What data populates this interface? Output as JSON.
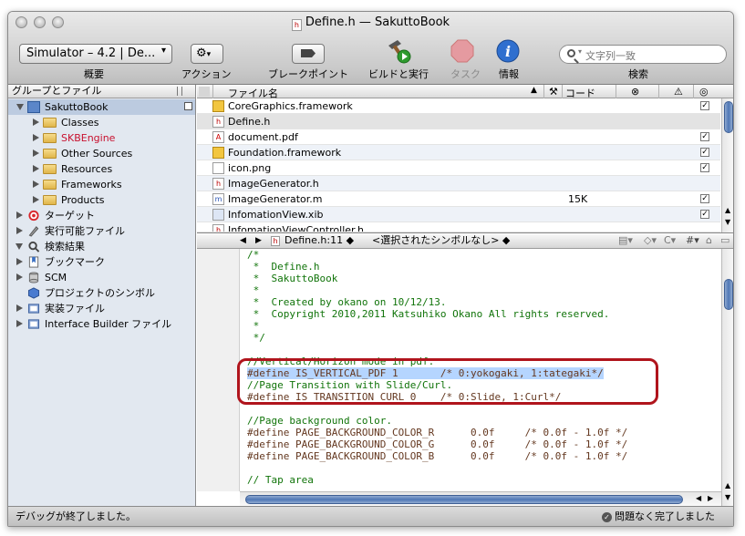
{
  "window": {
    "title": "Define.h — SakuttoBook",
    "doc_icon": "h"
  },
  "toolbar": {
    "overview_value": "Simulator – 4.2 | De...",
    "overview_label": "概要",
    "action_label": "アクション",
    "breakpoints_label": "ブレークポイント",
    "build_run_label": "ビルドと実行",
    "tasks_label": "タスク",
    "info_label": "情報",
    "search_placeholder": "文字列一致",
    "search_label": "検索"
  },
  "sidebar": {
    "header": "グループとファイル",
    "items": [
      {
        "label": "SakuttoBook",
        "icon": "project-icon"
      },
      {
        "label": "Classes",
        "icon": "folder-icon"
      },
      {
        "label": "SKBEngine",
        "icon": "folder-icon",
        "color": "#c8102e"
      },
      {
        "label": "Other Sources",
        "icon": "folder-icon"
      },
      {
        "label": "Resources",
        "icon": "folder-icon"
      },
      {
        "label": "Frameworks",
        "icon": "folder-icon"
      },
      {
        "label": "Products",
        "icon": "folder-icon"
      },
      {
        "label": "ターゲット",
        "icon": "target-icon"
      },
      {
        "label": "実行可能ファイル",
        "icon": "executable-icon"
      },
      {
        "label": "検索結果",
        "icon": "magnifier-icon"
      },
      {
        "label": "ブックマーク",
        "icon": "bookmark-icon"
      },
      {
        "label": "SCM",
        "icon": "scm-icon"
      },
      {
        "label": "プロジェクトのシンボル",
        "icon": "cube-icon"
      },
      {
        "label": "実装ファイル",
        "icon": "implementation-icon"
      },
      {
        "label": "Interface Builder ファイル",
        "icon": "ib-icon"
      }
    ]
  },
  "filelist": {
    "col_name": "ファイル名",
    "col_code": "コード",
    "files": [
      {
        "name": "CoreGraphics.framework",
        "code": "",
        "checked": true,
        "icon": "framework-icon"
      },
      {
        "name": "Define.h",
        "code": "",
        "checked": false,
        "icon": "header-icon"
      },
      {
        "name": "document.pdf",
        "code": "",
        "checked": true,
        "icon": "pdf-icon"
      },
      {
        "name": "Foundation.framework",
        "code": "",
        "checked": true,
        "icon": "framework-icon"
      },
      {
        "name": "icon.png",
        "code": "",
        "checked": true,
        "icon": "image-icon"
      },
      {
        "name": "ImageGenerator.h",
        "code": "",
        "checked": false,
        "icon": "header-icon"
      },
      {
        "name": "ImageGenerator.m",
        "code": "15K",
        "checked": true,
        "icon": "source-icon"
      },
      {
        "name": "InfomationView.xib",
        "code": "",
        "checked": true,
        "icon": "xib-icon"
      },
      {
        "name": "InfomationViewController.h",
        "code": "",
        "checked": false,
        "icon": "header-icon"
      }
    ]
  },
  "editor": {
    "file_position": "Define.h:11 ◆",
    "symbol": "<選択されたシンボルなし> ◆",
    "lines": [
      {
        "text": "/*",
        "style": "cm"
      },
      {
        "text": " *  Define.h",
        "style": "cm"
      },
      {
        "text": " *  SakuttoBook",
        "style": "cm"
      },
      {
        "text": " *",
        "style": "cm"
      },
      {
        "text": " *  Created by okano on 10/12/13.",
        "style": "cm"
      },
      {
        "text": " *  Copyright 2010,2011 Katsuhiko Okano All rights reserved.",
        "style": "cm"
      },
      {
        "text": " *",
        "style": "cm"
      },
      {
        "text": " */",
        "style": "cm"
      },
      {
        "text": "",
        "style": ""
      },
      {
        "text": "//Vertical/Horizon mode in pdf.",
        "style": "cm"
      },
      {
        "text": "#define IS_VERTICAL_PDF 1       /* 0:yokogaki, 1:tategaki*/",
        "style": "pp hl"
      },
      {
        "text": "//Page Transition with Slide/Curl.",
        "style": "cm"
      },
      {
        "text": "#define IS_TRANSITION_CURL 0    /* 0:Slide, 1:Curl*/",
        "style": "pp"
      },
      {
        "text": "",
        "style": ""
      },
      {
        "text": "//Page background color.",
        "style": "cm"
      },
      {
        "text": "#define PAGE_BACKGROUND_COLOR_R      0.0f     /* 0.0f - 1.0f */",
        "style": "pp"
      },
      {
        "text": "#define PAGE_BACKGROUND_COLOR_G      0.0f     /* 0.0f - 1.0f */",
        "style": "pp"
      },
      {
        "text": "#define PAGE_BACKGROUND_COLOR_B      0.0f     /* 0.0f - 1.0f */",
        "style": "pp"
      },
      {
        "text": "",
        "style": ""
      },
      {
        "text": "// Tap area",
        "style": "cm"
      }
    ]
  },
  "status": {
    "left": "デバッグが終了しました。",
    "right": "問題なく完了しました"
  }
}
